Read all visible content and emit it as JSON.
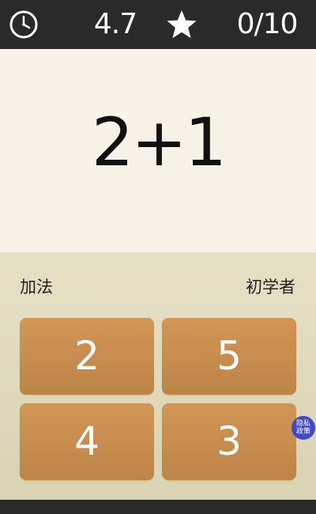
{
  "header": {
    "timer_icon": "clock-icon",
    "timer_value": "4.7",
    "score_icon": "star-icon",
    "score_value": "0/10"
  },
  "question": {
    "expression": "2+1"
  },
  "info": {
    "mode": "加法",
    "level": "初学者"
  },
  "answers": [
    {
      "label": "2"
    },
    {
      "label": "5"
    },
    {
      "label": "4"
    },
    {
      "label": "3"
    }
  ],
  "privacy_badge": {
    "label": "隐私政策"
  },
  "colors": {
    "top_bar": "#2a2a2a",
    "question_bg": "#f6f2e7",
    "answer_area_bg": "#e2ddbf",
    "answer_button": "#c88c4f",
    "privacy_badge": "#3f4ac8"
  }
}
